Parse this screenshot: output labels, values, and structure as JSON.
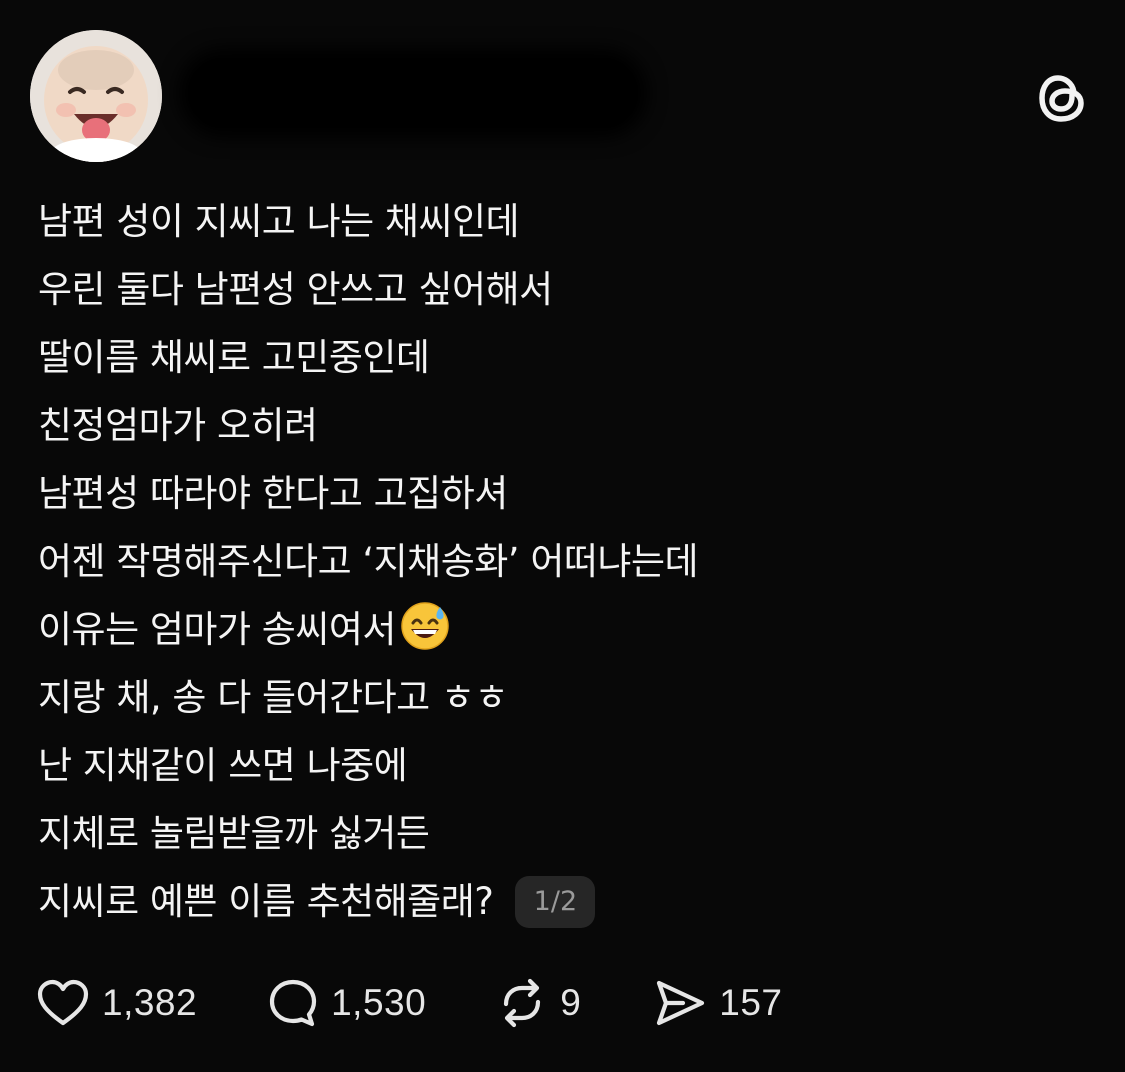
{
  "post": {
    "lines": [
      "남편 성이 지씨고 나는 채씨인데",
      "우린 둘다 남편성 안쓰고 싶어해서",
      "딸이름 채씨로 고민중인데",
      "친정엄마가 오히려",
      "남편성 따라야 한다고 고집하셔",
      "어젠 작명해주신다고 ‘지채송화’ 어떠냐는데",
      "이유는 엄마가 송씨여서",
      "지랑 채, 송 다 들어간다고 ㅎㅎ",
      "난 지채같이 쓰면 나중에",
      "지체로 놀림받을까 싫거든",
      "지씨로 예쁜 이름 추천해줄래?"
    ],
    "emoji": "grinning-face-with-sweat",
    "page_indicator": "1/2"
  },
  "actions": {
    "likes": "1,382",
    "replies": "1,530",
    "reposts": "9",
    "shares": "157"
  },
  "icons": {
    "like": "heart-icon",
    "reply": "speech-bubble-icon",
    "repost": "repost-icon",
    "share": "send-icon",
    "brand": "threads-logo-icon"
  },
  "colors": {
    "background": "#080808",
    "text": "#f4f4f4",
    "badge_bg": "#262626",
    "badge_text": "#9a9a9a"
  }
}
